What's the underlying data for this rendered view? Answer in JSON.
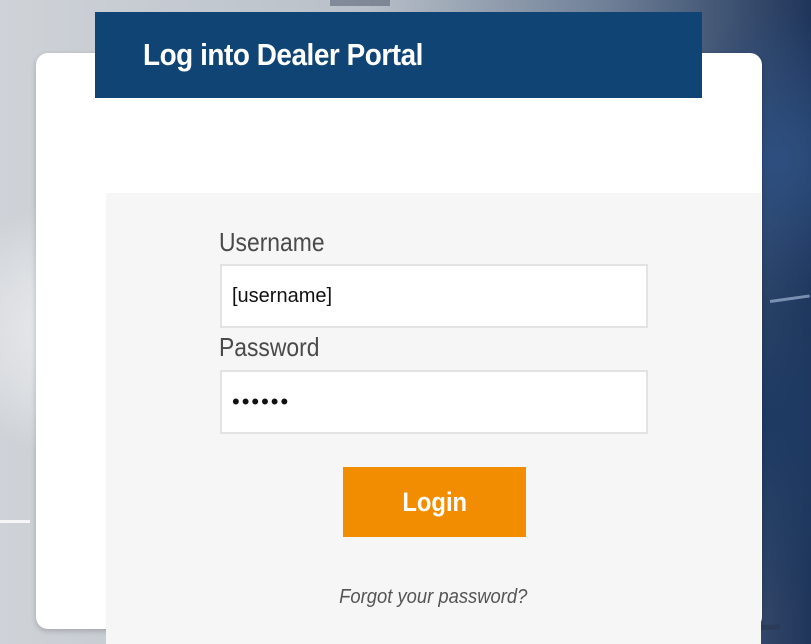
{
  "header": {
    "title": "Log into Dealer Portal"
  },
  "form": {
    "username_label": "Username",
    "username_value": "[username]",
    "password_label": "Password",
    "password_value": "••••••",
    "login_label": "Login",
    "forgot_label": "Forgot your password?"
  },
  "colors": {
    "header_bg": "#0f4474",
    "button_bg": "#f28c00",
    "panel_bg": "#f6f6f6"
  }
}
